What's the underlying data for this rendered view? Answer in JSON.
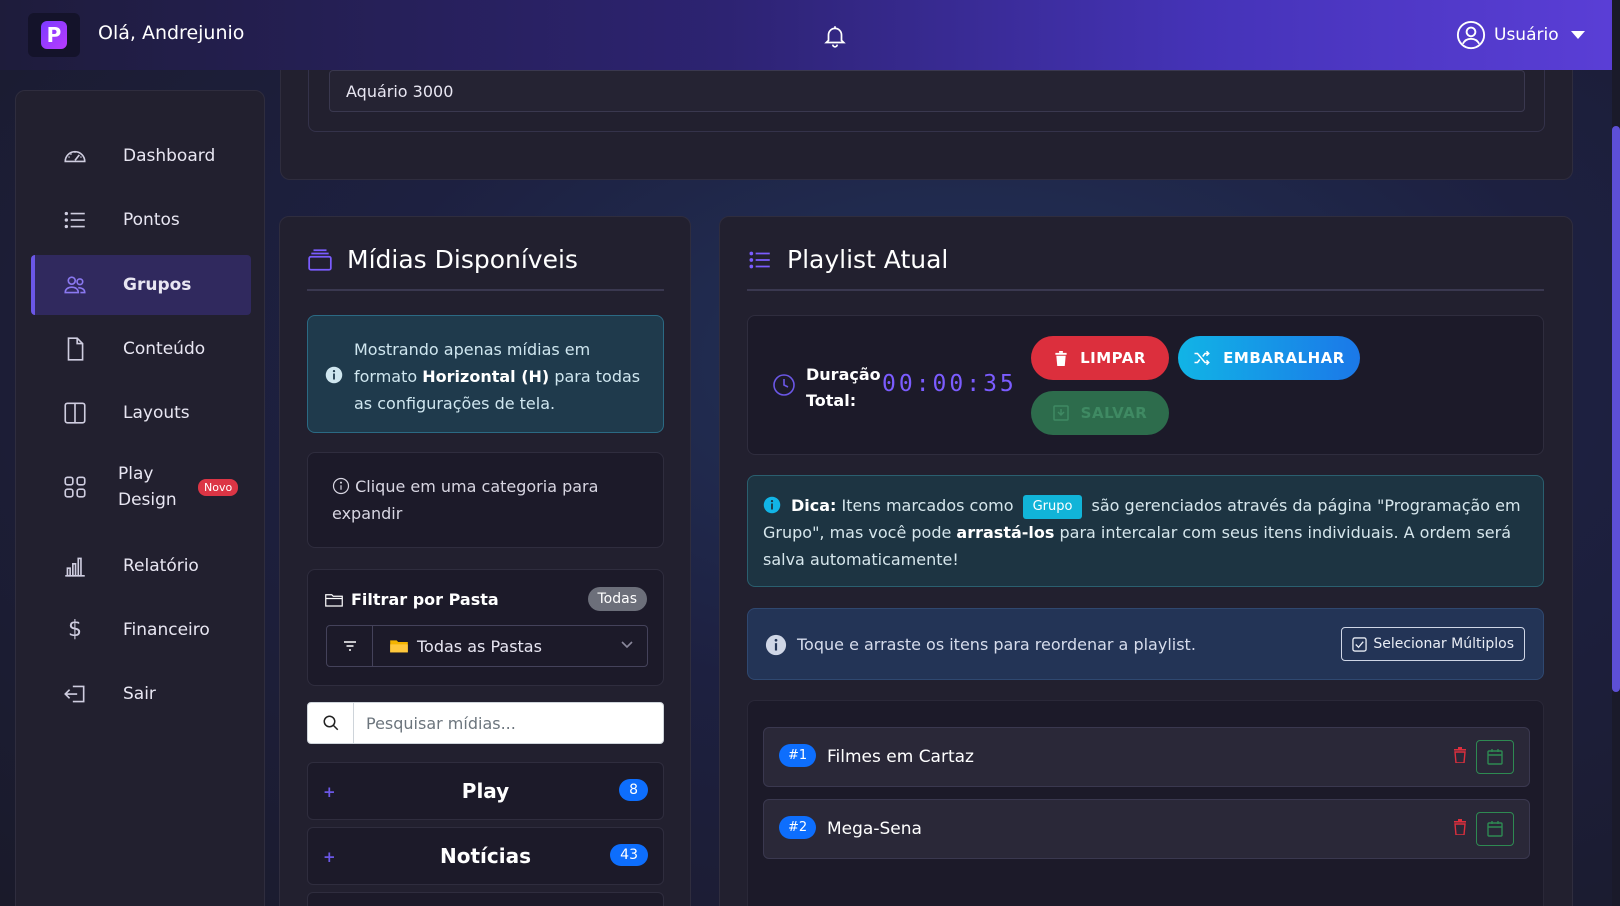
{
  "header": {
    "greeting": "Olá, Andrejunio",
    "user_label": "Usuário"
  },
  "sidebar": {
    "items": [
      {
        "label": "Dashboard",
        "icon": "speedometer-icon"
      },
      {
        "label": "Pontos",
        "icon": "list-icon"
      },
      {
        "label": "Grupos",
        "icon": "people-icon",
        "active": true
      },
      {
        "label": "Conteúdo",
        "icon": "file-icon"
      },
      {
        "label": "Layouts",
        "icon": "layout-icon"
      },
      {
        "label": "Play Design",
        "icon": "grid-icon",
        "badge": "Novo"
      },
      {
        "label": "Relatório",
        "icon": "bar-chart-icon"
      },
      {
        "label": "Financeiro",
        "icon": "dollar-icon"
      },
      {
        "label": "Sair",
        "icon": "logout-icon"
      }
    ]
  },
  "top_field": {
    "value": "Aquário 3000"
  },
  "midias": {
    "title": "Mídias Disponíveis",
    "info": {
      "prefix": "Mostrando apenas mídias em formato ",
      "bold": "Horizontal (H)",
      "suffix": " para todas as configurações de tela."
    },
    "hint": "Clique em uma categoria para expandir",
    "filter": {
      "title": "Filtrar por Pasta",
      "pill": "Todas",
      "selected": "Todas as Pastas"
    },
    "search_placeholder": "Pesquisar mídias...",
    "categories": [
      {
        "name": "Play",
        "count": "8"
      },
      {
        "name": "Notícias",
        "count": "43"
      }
    ]
  },
  "playlist": {
    "title": "Playlist Atual",
    "duration_label": "Duração Total:",
    "duration": "00:00:35",
    "buttons": {
      "limpar": "LIMPAR",
      "embaralhar": "EMBARALHAR",
      "salvar": "SALVAR"
    },
    "tip": {
      "label": "Dica:",
      "t1": " Itens marcados como ",
      "tag": "Grupo",
      "t2": " são gerenciados através da página \"Programação em Grupo\", mas você pode ",
      "bold": "arrastá-los",
      "t3": " para intercalar com seus itens individuais. A ordem será salva automaticamente!"
    },
    "drag_hint": "Toque e arraste os itens para reordenar a playlist.",
    "select_multiple": "Selecionar Múltiplos",
    "items": [
      {
        "num": "#1",
        "name": "Filmes em Cartaz"
      },
      {
        "num": "#2",
        "name": "Mega-Sena"
      }
    ]
  },
  "colors": {
    "accent": "#6b57e6",
    "danger": "#dc2f3d",
    "info": "#11b4e6",
    "primary": "#0d6efd",
    "success": "#2d6c4c"
  }
}
